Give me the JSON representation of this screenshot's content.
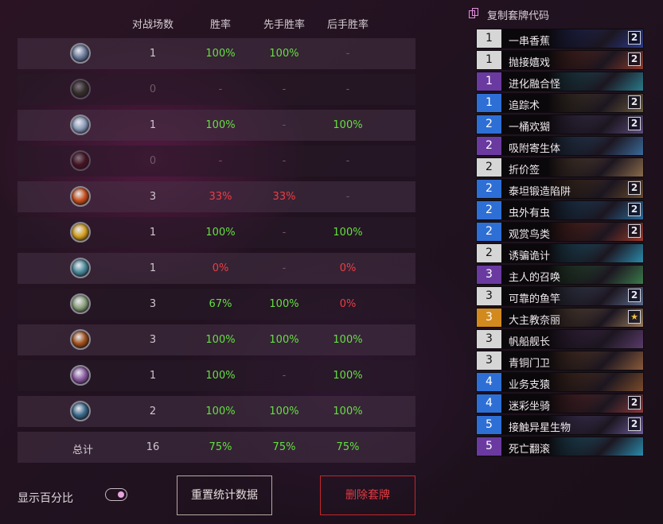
{
  "headers": {
    "games": "对战场数",
    "winrate": "胜率",
    "first": "先手胜率",
    "second": "后手胜率"
  },
  "rows": [
    {
      "icon": "class-icon-1",
      "color": "#6a7a9a",
      "games": "1",
      "winrate": "100%",
      "first": "100%",
      "second": "-"
    },
    {
      "icon": "class-icon-2",
      "color": "#3c4a2a",
      "games": "0",
      "winrate": "-",
      "first": "-",
      "second": "-"
    },
    {
      "icon": "class-icon-3",
      "color": "#8a9ab8",
      "games": "1",
      "winrate": "100%",
      "first": "-",
      "second": "100%"
    },
    {
      "icon": "class-icon-4",
      "color": "#5a1010",
      "games": "0",
      "winrate": "-",
      "first": "-",
      "second": "-"
    },
    {
      "icon": "class-icon-5",
      "color": "#c8501a",
      "games": "3",
      "winrate": "33%",
      "first": "33%",
      "second": "-"
    },
    {
      "icon": "class-icon-6",
      "color": "#d4a020",
      "games": "1",
      "winrate": "100%",
      "first": "-",
      "second": "100%"
    },
    {
      "icon": "class-icon-7",
      "color": "#4a8a9a",
      "games": "1",
      "winrate": "0%",
      "first": "-",
      "second": "0%"
    },
    {
      "icon": "class-icon-8",
      "color": "#8aa07a",
      "games": "3",
      "winrate": "67%",
      "first": "100%",
      "second": "0%"
    },
    {
      "icon": "class-icon-9",
      "color": "#a0501a",
      "games": "3",
      "winrate": "100%",
      "first": "100%",
      "second": "100%"
    },
    {
      "icon": "class-icon-10",
      "color": "#8a5aa0",
      "games": "1",
      "winrate": "100%",
      "first": "-",
      "second": "100%"
    },
    {
      "icon": "class-icon-11",
      "color": "#3a6a8a",
      "games": "2",
      "winrate": "100%",
      "first": "100%",
      "second": "100%"
    }
  ],
  "total": {
    "label": "总计",
    "games": "16",
    "winrate": "75%",
    "first": "75%",
    "second": "75%"
  },
  "controls": {
    "show_percent_label": "显示百分比",
    "reset_label": "重置统计数据",
    "delete_label": "删除套牌"
  },
  "deck": {
    "copy_label": "复制套牌代码",
    "cards": [
      {
        "cost": "1",
        "name": "一串香蕉",
        "count": "2",
        "rarity": "common",
        "art": "#2a3a8a"
      },
      {
        "cost": "1",
        "name": "抛接嬉戏",
        "count": "2",
        "rarity": "common",
        "art": "#8a3a2a"
      },
      {
        "cost": "1",
        "name": "进化融合怪",
        "count": "",
        "rarity": "epic",
        "art": "#2a7a8a"
      },
      {
        "cost": "1",
        "name": "追踪术",
        "count": "2",
        "rarity": "rare",
        "art": "#6a5a3a"
      },
      {
        "cost": "2",
        "name": "一桶欢猢",
        "count": "2",
        "rarity": "rare",
        "art": "#5a4a7a"
      },
      {
        "cost": "2",
        "name": "吸附寄生体",
        "count": "",
        "rarity": "epic",
        "art": "#3a6a9a"
      },
      {
        "cost": "2",
        "name": "折价签",
        "count": "",
        "rarity": "common",
        "art": "#8a6a4a"
      },
      {
        "cost": "2",
        "name": "泰坦锻造陷阱",
        "count": "2",
        "rarity": "rare",
        "art": "#6a4a2a"
      },
      {
        "cost": "2",
        "name": "虫外有虫",
        "count": "2",
        "rarity": "rare",
        "art": "#2a6a9a"
      },
      {
        "cost": "2",
        "name": "观赏鸟类",
        "count": "2",
        "rarity": "rare",
        "art": "#9a3a2a"
      },
      {
        "cost": "2",
        "name": "诱骗诡计",
        "count": "",
        "rarity": "common",
        "art": "#2a8aaa"
      },
      {
        "cost": "3",
        "name": "主人的召唤",
        "count": "",
        "rarity": "epic",
        "art": "#3a7a4a"
      },
      {
        "cost": "3",
        "name": "可靠的鱼竿",
        "count": "2",
        "rarity": "common",
        "art": "#5a6a8a"
      },
      {
        "cost": "3",
        "name": "大主教奈丽",
        "count": "★",
        "rarity": "legendary",
        "art": "#9a7a5a"
      },
      {
        "cost": "3",
        "name": "帆船舰长",
        "count": "",
        "rarity": "common",
        "art": "#5a3a6a"
      },
      {
        "cost": "3",
        "name": "青铜门卫",
        "count": "",
        "rarity": "common",
        "art": "#8a5a3a"
      },
      {
        "cost": "4",
        "name": "业务支猿",
        "count": "",
        "rarity": "rare",
        "art": "#7a4a2a"
      },
      {
        "cost": "4",
        "name": "迷彩坐骑",
        "count": "2",
        "rarity": "rare",
        "art": "#8a3a3a"
      },
      {
        "cost": "5",
        "name": "接触异星生物",
        "count": "2",
        "rarity": "rare",
        "art": "#6a5a9a"
      },
      {
        "cost": "5",
        "name": "死亡翻滚",
        "count": "",
        "rarity": "epic",
        "art": "#2a8aaa"
      }
    ]
  },
  "colors": {
    "positive": "#63e040",
    "negative": "#ee3d42",
    "rarity": {
      "common": "#d6d6d6",
      "rare": "#2e6fd6",
      "epic": "#6a3aa0",
      "legendary": "#d28a1e"
    }
  }
}
